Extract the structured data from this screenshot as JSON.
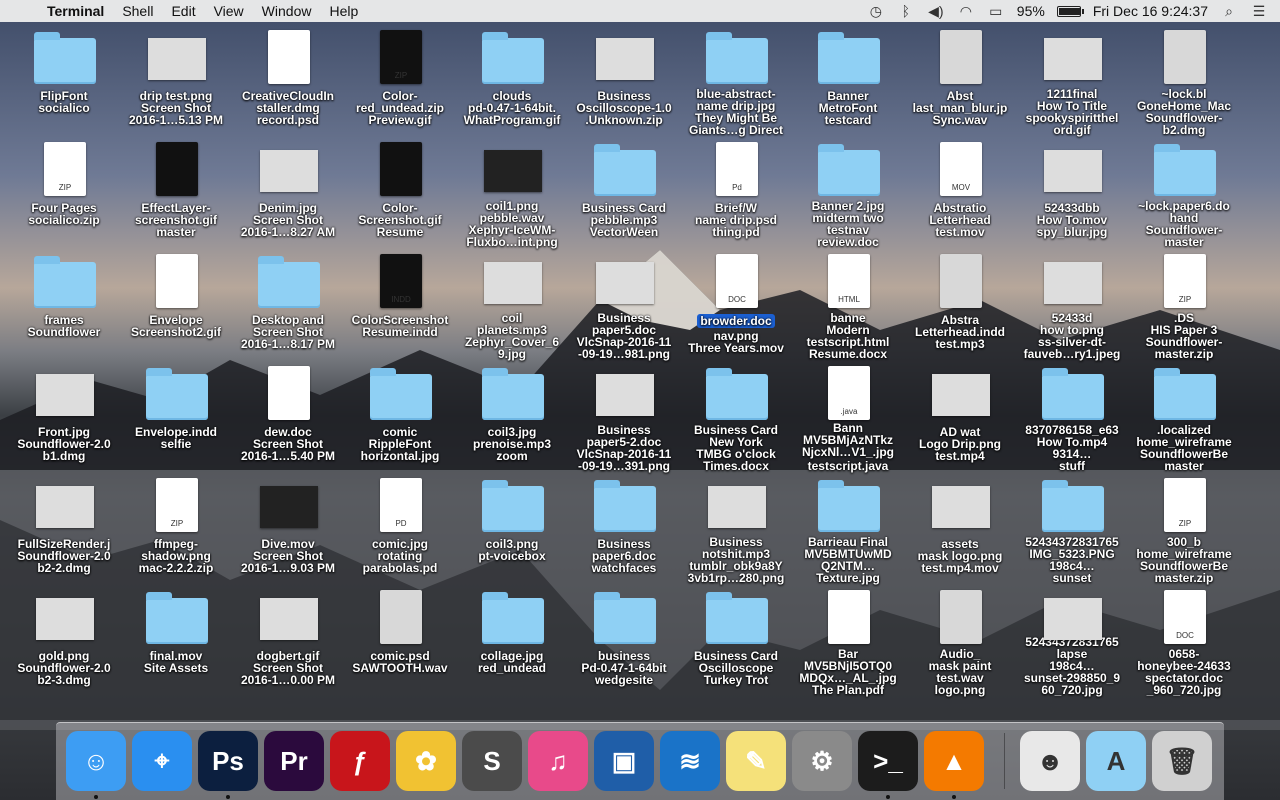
{
  "menubar": {
    "app": "Terminal",
    "items": [
      "Shell",
      "Edit",
      "View",
      "Window",
      "Help"
    ],
    "battery_pct": "95%",
    "battery_fill": 0.95,
    "clock": "Fri Dec 16  9:24:37"
  },
  "desktop": [
    {
      "label": "FlipFont\nsocialico",
      "kind": "folder",
      "col": 0,
      "row": 0
    },
    {
      "label": "drip test.png\nScreen Shot\n2016-1…5.13 PM",
      "kind": "thumb",
      "col": 1,
      "row": 0
    },
    {
      "label": "CreativeCloudIn\nstaller.dmg\nrecord.psd",
      "kind": "doc",
      "col": 2,
      "row": 0
    },
    {
      "label": "Color-\nred_undead.zip\nPreview.gif",
      "kind": "doc-dark",
      "tag": "ZIP",
      "col": 3,
      "row": 0
    },
    {
      "label": "clouds\npd-0.47-1-64bit.\nWhatProgram.gif",
      "kind": "folder",
      "col": 4,
      "row": 0
    },
    {
      "label": "Business\nOscilloscope-1.0\n.Unknown.zip",
      "kind": "thumb",
      "col": 5,
      "row": 0
    },
    {
      "label": "blue-abstract-\nname drip.jpg\nThey Might Be\nGiants…g Direct",
      "kind": "folder",
      "col": 6,
      "row": 0
    },
    {
      "label": "Banner\nMetroFont\ntestcard",
      "kind": "folder",
      "col": 7,
      "row": 0
    },
    {
      "label": "Abst\nlast_man_blur.jp\nSync.wav",
      "kind": "doc-mid",
      "col": 8,
      "row": 0
    },
    {
      "label": "1211final\nHow To Title\nspookyspiritthel\nord.gif",
      "kind": "thumb",
      "col": 9,
      "row": 0
    },
    {
      "label": "~lock.bl\nGoneHome_Mac\nSoundflower-\nb2.dmg",
      "kind": "doc-mid",
      "col": 10,
      "row": 0
    },
    {
      "label": "Four Pages\nsocialico.zip",
      "kind": "doc",
      "tag": "ZIP",
      "col": 0,
      "row": 1
    },
    {
      "label": "EffectLayer-\nscreenshot.gif\nmaster",
      "kind": "doc-dark",
      "col": 1,
      "row": 1
    },
    {
      "label": "Denim.jpg\nScreen Shot\n2016-1…8.27 AM",
      "kind": "thumb",
      "col": 2,
      "row": 1
    },
    {
      "label": "Color-\nScreenshot.gif\nResume",
      "kind": "doc-dark",
      "col": 3,
      "row": 1
    },
    {
      "label": "coil1.png\npebble.wav\nXephyr-IceWM-\nFluxbo…int.png",
      "kind": "thumb-dark",
      "col": 4,
      "row": 1
    },
    {
      "label": "Business Card\npebble.mp3\nVectorWeen",
      "kind": "folder",
      "col": 5,
      "row": 1
    },
    {
      "label": "Brief/W\nname drip.psd\nthing.pd",
      "kind": "doc",
      "tag": "Pd",
      "col": 6,
      "row": 1
    },
    {
      "label": "Banner 2.jpg\nmidterm two\ntestnav\nreview.doc",
      "kind": "folder",
      "col": 7,
      "row": 1
    },
    {
      "label": "Abstratio\nLetterhead\ntest.mov",
      "kind": "doc",
      "tag": "MOV",
      "col": 8,
      "row": 1
    },
    {
      "label": "52433dbb\nHow To.mov\nspy_blur.jpg",
      "kind": "thumb",
      "col": 9,
      "row": 1
    },
    {
      "label": "~lock.paper6.do\nhand\nSoundflower-\nmaster",
      "kind": "folder",
      "col": 10,
      "row": 1
    },
    {
      "label": "frames\nSoundflower",
      "kind": "folder",
      "col": 0,
      "row": 2
    },
    {
      "label": "Envelope\nScreenshot2.gif",
      "kind": "doc",
      "col": 1,
      "row": 2
    },
    {
      "label": "Desktop and\nScreen Shot\n2016-1…8.17 PM",
      "kind": "folder",
      "col": 2,
      "row": 2
    },
    {
      "label": "ColorScreenshot\nResume.indd",
      "kind": "doc-dark",
      "tag": "INDD",
      "col": 3,
      "row": 2
    },
    {
      "label": "coil\nplanets.mp3\nZephyr_Cover_6\n9.jpg",
      "kind": "thumb",
      "col": 4,
      "row": 2
    },
    {
      "label": "Business\npaper5.doc\nVlcSnap-2016-11\n-09-19…981.png",
      "kind": "thumb",
      "col": 5,
      "row": 2
    },
    {
      "label": "browder.doc",
      "kind": "doc",
      "tag": "DOC",
      "sel": true,
      "extra": "nav.png\nThree Years.mov",
      "col": 6,
      "row": 2
    },
    {
      "label": "banne\nModern\ntestscript.html\nResume.docx",
      "kind": "doc",
      "tag": "HTML",
      "col": 7,
      "row": 2
    },
    {
      "label": "Abstra\nLetterhead.indd\ntest.mp3",
      "kind": "doc-mid",
      "col": 8,
      "row": 2
    },
    {
      "label": "52433d\nhow to.png\nss-silver-dt-\nfauveb…ry1.jpeg",
      "kind": "thumb",
      "col": 9,
      "row": 2
    },
    {
      "label": ".DS\nHIS Paper 3\nSoundflower-\nmaster.zip",
      "kind": "doc",
      "tag": "ZIP",
      "col": 10,
      "row": 2
    },
    {
      "label": "Front.jpg\nSoundflower-2.0\nb1.dmg",
      "kind": "thumb",
      "col": 0,
      "row": 3
    },
    {
      "label": "Envelope.indd\nselfie",
      "kind": "folder",
      "col": 1,
      "row": 3
    },
    {
      "label": "dew.doc\nScreen Shot\n2016-1…5.40 PM",
      "kind": "doc",
      "col": 2,
      "row": 3
    },
    {
      "label": "comic\nRippleFont\nhorizontal.jpg",
      "kind": "folder",
      "col": 3,
      "row": 3
    },
    {
      "label": "coil3.jpg\nprenoise.mp3\nzoom",
      "kind": "folder",
      "col": 4,
      "row": 3
    },
    {
      "label": "Business\npaper5-2.doc\nVlcSnap-2016-11\n-09-19…391.png",
      "kind": "thumb",
      "col": 5,
      "row": 3
    },
    {
      "label": "Business Card\nNew York\nTMBG o'clock\nTimes.docx",
      "kind": "folder",
      "col": 6,
      "row": 3
    },
    {
      "label": "Bann\nMV5BMjAzNTkz\nNjcxNl…V1_.jpg",
      "kind": "doc",
      "tag": ".java",
      "extra": "testscript.java",
      "col": 7,
      "row": 3
    },
    {
      "label": "AD wat\nLogo Drip.png\ntest.mp4",
      "kind": "thumb",
      "col": 8,
      "row": 3
    },
    {
      "label": "8370786158_e63\nHow To.mp4\n9314…\nstuff",
      "kind": "folder",
      "col": 9,
      "row": 3
    },
    {
      "label": ".localized\nhome_wireframe\nSoundflowerBe\nmaster",
      "kind": "folder",
      "col": 10,
      "row": 3
    },
    {
      "label": "FullSizeRender.j\nSoundflower-2.0\nb2-2.dmg",
      "kind": "thumb",
      "col": 0,
      "row": 4
    },
    {
      "label": "ffmpeg-\nshadow.png\nmac-2.2.2.zip",
      "kind": "doc",
      "tag": "ZIP",
      "col": 1,
      "row": 4
    },
    {
      "label": "Dive.mov\nScreen Shot\n2016-1…9.03 PM",
      "kind": "thumb-dark",
      "col": 2,
      "row": 4
    },
    {
      "label": "comic.jpg\nrotating\nparabolas.pd",
      "kind": "doc",
      "tag": "PD",
      "col": 3,
      "row": 4
    },
    {
      "label": "coil3.png\npt-voicebox",
      "kind": "folder",
      "col": 4,
      "row": 4
    },
    {
      "label": "Business\npaper6.doc\nwatchfaces",
      "kind": "folder",
      "col": 5,
      "row": 4
    },
    {
      "label": "Business\nnotshit.mp3\ntumblr_obk9a8Y\n3vb1rp…280.png",
      "kind": "thumb",
      "col": 6,
      "row": 4
    },
    {
      "label": "Barrieau Final\nMV5BMTUwMD\nQ2NTM…Texture.jpg",
      "kind": "folder",
      "col": 7,
      "row": 4
    },
    {
      "label": "assets\nmask logo.png\ntest.mp4.mov",
      "kind": "thumb",
      "col": 8,
      "row": 4
    },
    {
      "label": "52434372831765\nIMG_5323.PNG\n198c4…\nsunset",
      "kind": "folder",
      "col": 9,
      "row": 4
    },
    {
      "label": "300_b\nhome_wireframe\nSoundflowerBe\nmaster.zip",
      "kind": "doc",
      "tag": "ZIP",
      "col": 10,
      "row": 4
    },
    {
      "label": "gold.png\nSoundflower-2.0\nb2-3.dmg",
      "kind": "thumb",
      "col": 0,
      "row": 5
    },
    {
      "label": "final.mov\nSite Assets",
      "kind": "folder",
      "col": 1,
      "row": 5
    },
    {
      "label": "dogbert.gif\nScreen Shot\n2016-1…0.00 PM",
      "kind": "thumb",
      "col": 2,
      "row": 5
    },
    {
      "label": "comic.psd\nSAWTOOTH.wav",
      "kind": "doc-mid",
      "col": 3,
      "row": 5
    },
    {
      "label": "collage.jpg\nred_undead",
      "kind": "folder",
      "col": 4,
      "row": 5
    },
    {
      "label": "business\nPd-0.47-1-64bit\nwedgesite",
      "kind": "folder",
      "col": 5,
      "row": 5
    },
    {
      "label": "Business Card\nOscilloscope\nTurkey Trot",
      "kind": "folder",
      "col": 6,
      "row": 5
    },
    {
      "label": "Bar\nMV5BNjI5OTQ0\nMDQx…_AL_.jpg\nThe Plan.pdf",
      "kind": "doc",
      "col": 7,
      "row": 5
    },
    {
      "label": "Audio_\nmask paint\ntest.wav\nlogo.png",
      "kind": "doc-mid",
      "col": 8,
      "row": 5
    },
    {
      "label": "52434372831765\nlapse\n198c4…\nsunset-298850_9\n60_720.jpg",
      "kind": "thumb",
      "col": 9,
      "row": 5
    },
    {
      "label": "0658-\nhoneybee-24633\nspectator.doc\n_960_720.jpg",
      "kind": "doc",
      "tag": "DOC",
      "col": 10,
      "row": 5
    }
  ],
  "dock": [
    {
      "name": "finder-icon",
      "glyph": "☺",
      "color": "#3d9df3",
      "running": true
    },
    {
      "name": "safari-icon",
      "glyph": "⌖",
      "color": "#2a8ff0",
      "running": false
    },
    {
      "name": "photoshop-icon",
      "glyph": "Ps",
      "color": "#0c1f3f",
      "running": true
    },
    {
      "name": "premiere-icon",
      "glyph": "Pr",
      "color": "#2b0a3d",
      "running": false
    },
    {
      "name": "flash-icon",
      "glyph": "ƒ",
      "color": "#c8151b",
      "running": false
    },
    {
      "name": "cyberduck-icon",
      "glyph": "✿",
      "color": "#f1c232",
      "running": false
    },
    {
      "name": "sublime-icon",
      "glyph": "S",
      "color": "#4b4b4b",
      "running": false
    },
    {
      "name": "itunes-icon",
      "glyph": "♫",
      "color": "#e84a8a",
      "running": false
    },
    {
      "name": "virtualbox-icon",
      "glyph": "▣",
      "color": "#1f5ea8",
      "running": false
    },
    {
      "name": "openoffice-icon",
      "glyph": "≋",
      "color": "#1a73c8",
      "running": false
    },
    {
      "name": "notes-icon",
      "glyph": "✎",
      "color": "#f5e17a",
      "running": false
    },
    {
      "name": "system-preferences-icon",
      "glyph": "⚙",
      "color": "#8a8a8a",
      "running": false
    },
    {
      "name": "terminal-icon",
      "glyph": ">_",
      "color": "#1c1c1c",
      "running": true
    },
    {
      "name": "vlc-icon",
      "glyph": "▲",
      "color": "#f47a00",
      "running": true
    }
  ],
  "dock_right": [
    {
      "name": "user-folder-icon",
      "glyph": "☻",
      "color": "#e8e8e8"
    },
    {
      "name": "applications-folder-icon",
      "glyph": "A",
      "color": "#8fd0f4"
    },
    {
      "name": "trash-icon",
      "glyph": "🗑",
      "color": "#d0d0d0"
    }
  ]
}
